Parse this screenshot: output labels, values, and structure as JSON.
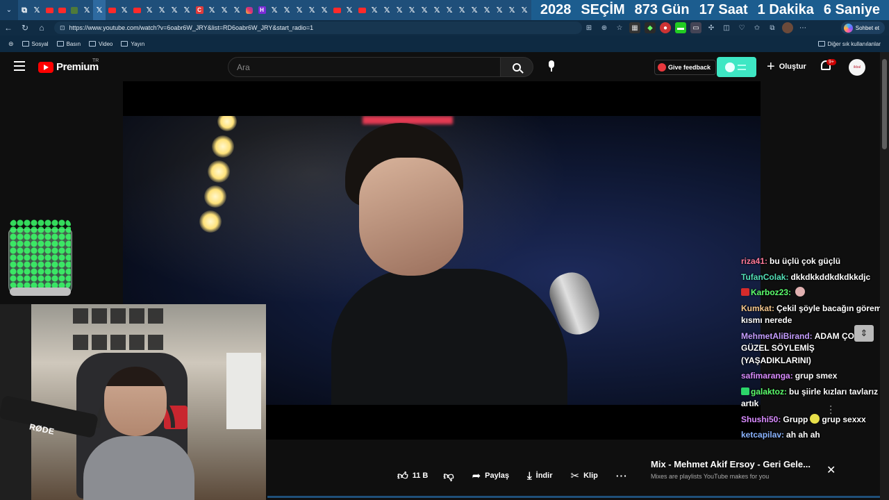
{
  "browser": {
    "tab_count_visible": 40,
    "active_tab_favicon": "x-icon",
    "countdown": [
      "2028",
      "SEÇİM",
      "873 Gün",
      "17 Saat",
      "1 Dakika",
      "6 Saniye"
    ],
    "url": "https://www.youtube.com/watch?v=6oabr6W_JRY&list=RD6oabr6W_JRY&start_radio=1",
    "copilot_label": "Sohbet et",
    "bookmarks": [
      "Sosyal",
      "Basın",
      "Video",
      "Yayın"
    ],
    "other_bookmarks": "Diğer sık kullanılanlar"
  },
  "masthead": {
    "logo": "Premium",
    "country": "TR",
    "search_placeholder": "Ara",
    "feedback_label": "Give feedback",
    "create_label": "Oluştur",
    "notification_badge": "9+"
  },
  "chat": [
    {
      "user": "riza41:",
      "text": "bu üçlü çok güçlü",
      "color": "#ff7a9a",
      "badge": null
    },
    {
      "user": "TufanColak:",
      "text": "dkkdkkddkdkdkkdjc",
      "color": "#53e0b8",
      "badge": null
    },
    {
      "user": "Karboz23:",
      "text": "",
      "color": "#5cff6d",
      "badge": "#d52b2b",
      "emote": "#e0b0b0"
    },
    {
      "user": "Kumkat:",
      "text": "Çekil şöyle bacağın görem kısmı nerede",
      "color": "#f4c68c",
      "badge": null
    },
    {
      "user": "MehmetAliBirand:",
      "text": "ADAM ÇOK GÜZEL SÖYLEMİŞ (YAŞADIKLARINI)",
      "color": "#c59dff",
      "badge": null
    },
    {
      "user": "safimaranga:",
      "text": "grup smex",
      "color": "#d98bff",
      "badge": null
    },
    {
      "user": "galaktoz:",
      "text": "bu şiirle kızları tavlarız artık",
      "color": "#5cff6d",
      "badge": "#2bd56a"
    },
    {
      "user": "Shushi50:",
      "text": "Grupp grup sexxx",
      "color": "#d98bff",
      "badge": null,
      "emote": "#e8e04a"
    },
    {
      "user": "ketcapilav:",
      "text": "ah ah ah",
      "color": "#8ab4ff",
      "badge": null
    }
  ],
  "actions": {
    "like_count": "11 B",
    "share_label": "Paylaş",
    "download_label": "İndir",
    "clip_label": "Klip",
    "more_label": "···"
  },
  "playlist": {
    "title": "Mix - Mehmet Akif Ersoy - Geri Gele...",
    "subtitle": "Mixes are playlists YouTube makes for you",
    "close_label": "✕"
  },
  "webcam": {
    "mic_brand": "RØDE"
  }
}
